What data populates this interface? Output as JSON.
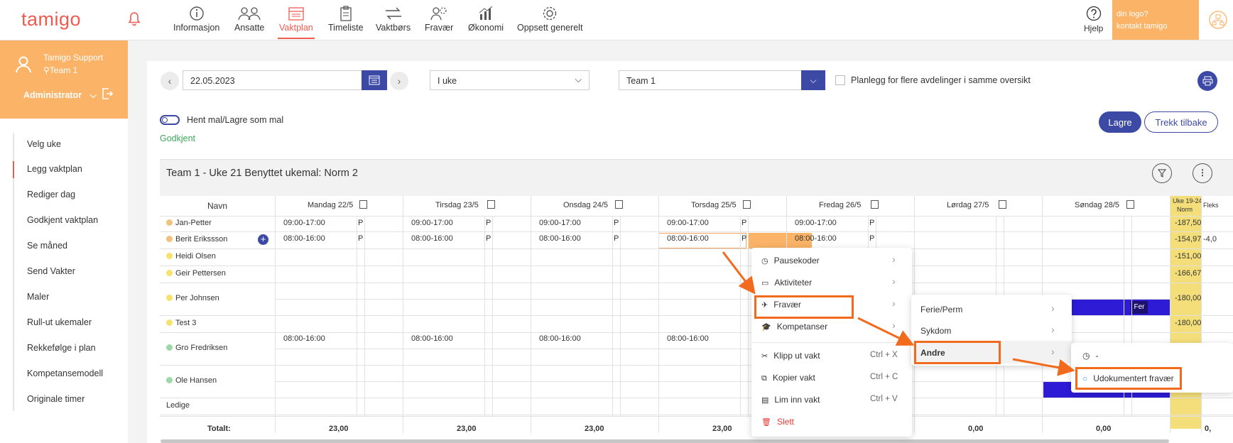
{
  "app": {
    "logo": "tamigo"
  },
  "nav": {
    "items": [
      {
        "label": "Informasjon"
      },
      {
        "label": "Ansatte"
      },
      {
        "label": "Vaktplan"
      },
      {
        "label": "Timeliste"
      },
      {
        "label": "Vaktbørs"
      },
      {
        "label": "Fravær"
      },
      {
        "label": "Økonomi"
      },
      {
        "label": "Oppsett generelt"
      }
    ],
    "help": "Hjelp",
    "logo_box": [
      "din logo?",
      "kontakt tamigo"
    ]
  },
  "user": {
    "name": "Tamigo Support",
    "team": "Team 1",
    "role": "Administrator"
  },
  "sidebar": {
    "items": [
      {
        "label": "Velg uke"
      },
      {
        "label": "Legg vaktplan"
      },
      {
        "label": "Rediger dag"
      },
      {
        "label": "Godkjent vaktplan"
      },
      {
        "label": "Se måned"
      },
      {
        "label": "Send Vakter"
      },
      {
        "label": "Maler"
      },
      {
        "label": "Rull-ut ukemaler"
      },
      {
        "label": "Rekkefølge i plan"
      },
      {
        "label": "Kompetansemodell"
      },
      {
        "label": "Originale timer"
      }
    ]
  },
  "toolbar": {
    "date": "22.05.2023",
    "period": "I uke",
    "team": "Team 1",
    "multi_dept_label": "Planlegg for flere avdelinger i samme oversikt",
    "template_toggle": "Hent mal/Lagre som mal",
    "status": "Godkjent",
    "save": "Lagre",
    "revert": "Trekk tilbake"
  },
  "schedule": {
    "title": "Team 1 - Uke 21 Benyttet ukemal: Norm 2",
    "name_header": "Navn",
    "days": [
      "Mandag 22/5",
      "Tirsdag 23/5",
      "Onsdag 24/5",
      "Torsdag 25/5",
      "Fredag 26/5",
      "Lørdag 27/5",
      "Søndag 28/5"
    ],
    "week_col": [
      "Uke 19-24",
      "Norm"
    ],
    "flex_col": "Fleks",
    "p": "P",
    "employees": [
      {
        "name": "Jan-Petter",
        "color": "#f1c27d",
        "norm": "-187,50",
        "shifts": [
          "09:00-17:00",
          "09:00-17:00",
          "09:00-17:00",
          "09:00-17:00",
          "09:00-17:00",
          "",
          ""
        ]
      },
      {
        "name": "Berit Erikssson",
        "color": "#f1c27d",
        "norm": "-154,97",
        "flex": "-4,0",
        "shifts": [
          "08:00-16:00",
          "08:00-16:00",
          "08:00-16:00",
          "08:00-16:00",
          "08:00-16:00",
          "",
          ""
        ]
      },
      {
        "name": "Heidi Olsen",
        "color": "#f7e26b",
        "norm": "-151,00",
        "shifts": [
          "",
          "",
          "",
          "",
          "",
          "",
          ""
        ]
      },
      {
        "name": "Geir Pettersen",
        "color": "#f7e26b",
        "norm": "-166,67",
        "shifts": [
          "",
          "",
          "",
          "",
          "",
          "",
          ""
        ]
      },
      {
        "name": "Per Johnsen",
        "color": "#f7e26b",
        "norm": "-180,00",
        "shifts": [
          "",
          "",
          "",
          "",
          "",
          "",
          ""
        ],
        "absence": "Fer"
      },
      {
        "name": "Test 3",
        "color": "#f7e26b",
        "norm": "-180,00",
        "shifts": [
          "",
          "",
          "",
          "",
          "",
          "",
          ""
        ]
      },
      {
        "name": "Gro Fredriksen",
        "color": "#9ed8a8",
        "norm": "",
        "shifts": [
          "08:00-16:00",
          "08:00-16:00",
          "08:00-16:00",
          "08:00-16:00",
          "",
          "",
          ""
        ]
      },
      {
        "name": "Ole Hansen",
        "color": "#9ed8a8",
        "norm": "",
        "shifts": [
          "",
          "",
          "",
          "",
          "",
          "",
          ""
        ]
      },
      {
        "name": "Ledige",
        "color": "",
        "norm": "",
        "shifts": [
          "",
          "",
          "",
          "",
          "",
          "",
          ""
        ]
      }
    ],
    "totals_label": "Totalt:",
    "totals": [
      "23,00",
      "23,00",
      "23,00",
      "23,00",
      "",
      "0,00",
      "0,00"
    ],
    "totals_extra": "0,"
  },
  "context_menu": {
    "items": [
      {
        "label": "Pausekoder",
        "icon": "clock-icon"
      },
      {
        "label": "Aktiviteter",
        "icon": "activity-icon"
      },
      {
        "label": "Fravær",
        "icon": "plane-icon"
      },
      {
        "label": "Kompetanser",
        "icon": "graduation-icon"
      },
      {
        "label": "Klipp ut vakt",
        "shortcut": "Ctrl + X",
        "icon": "scissors-icon"
      },
      {
        "label": "Kopier vakt",
        "shortcut": "Ctrl + C",
        "icon": "copy-icon"
      },
      {
        "label": "Lim inn vakt",
        "shortcut": "Ctrl + V",
        "icon": "paste-icon"
      },
      {
        "label": "Slett",
        "icon": "trash-icon"
      }
    ]
  },
  "submenu_absence": {
    "items": [
      {
        "label": "Ferie/Perm"
      },
      {
        "label": "Sykdom"
      },
      {
        "label": "Andre"
      }
    ]
  },
  "submenu_other": {
    "items": [
      {
        "label": "-"
      },
      {
        "label": "Udokumentert fravær"
      }
    ]
  },
  "colors": {
    "accent": "#ef5b4f",
    "orange": "#fbb367",
    "primary": "#3d4aa5",
    "highlight": "#f26b1d",
    "norm_yellow": "#f3de7a"
  }
}
